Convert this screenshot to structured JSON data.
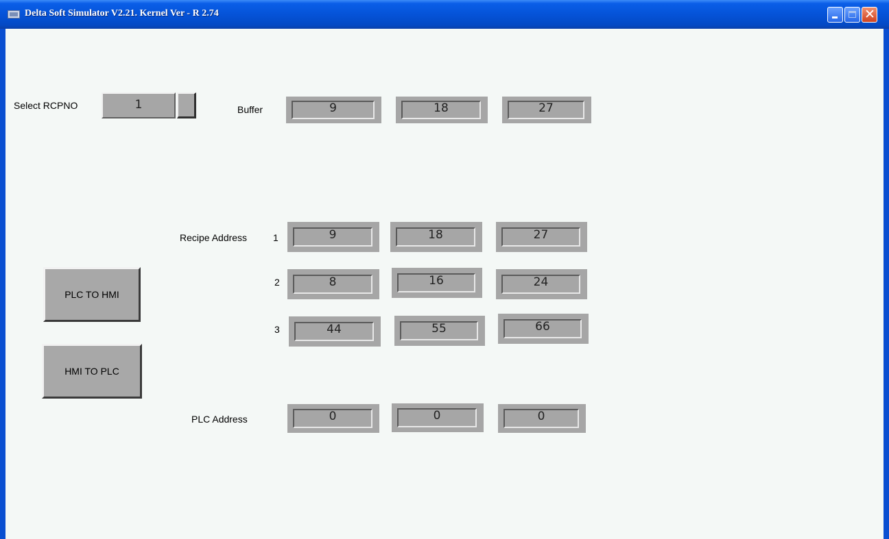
{
  "window": {
    "title": "Delta Soft Simulator V2.21. Kernel Ver - R 2.74"
  },
  "select": {
    "label": "Select RCPNO",
    "value": "1"
  },
  "buffer": {
    "label": "Buffer",
    "values": [
      "9",
      "18",
      "27"
    ]
  },
  "recipe": {
    "label": "Recipe Address",
    "rows": [
      {
        "index": "1",
        "values": [
          "9",
          "18",
          "27"
        ]
      },
      {
        "index": "2",
        "values": [
          "8",
          "16",
          "24"
        ]
      },
      {
        "index": "3",
        "values": [
          "44",
          "55",
          "66"
        ]
      }
    ]
  },
  "plc": {
    "label": "PLC Address",
    "values": [
      "0",
      "0",
      "0"
    ]
  },
  "buttons": {
    "plc_to_hmi": "PLC TO HMI",
    "hmi_to_plc": "HMI TO PLC"
  }
}
